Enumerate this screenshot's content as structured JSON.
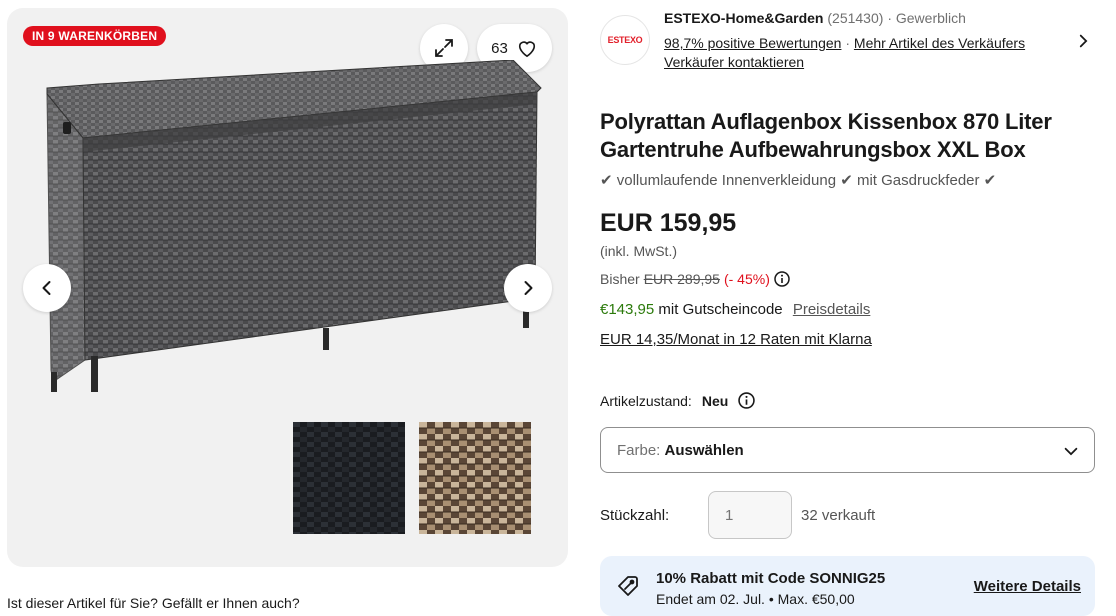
{
  "gallery": {
    "badge": "IN 9 WARENKÖRBEN",
    "watch_count": "63",
    "icons": {
      "expand": "expand-icon",
      "heart": "heart-icon",
      "prev": "chevron-left-icon",
      "next": "chevron-right-icon"
    }
  },
  "seller": {
    "logo_text": "ESTEXO",
    "name": "ESTEXO-Home&Garden",
    "score": "(251430)",
    "type": "Gewerblich",
    "separator": "·",
    "positive": "98,7% positive Bewertungen",
    "more_items": "Mehr Artikel des Verkäufers",
    "contact": "Verkäufer kontaktieren"
  },
  "product": {
    "title": "Polyrattan Auflagenbox Kissenbox 870 Liter Gartentruhe Aufbewahrungsbox XXL Box",
    "subtitle": "✔ vollumlaufende Innenverkleidung ✔ mit Gasdruckfeder ✔",
    "price": "EUR 159,95",
    "vat": "(inkl. MwSt.)",
    "was_label": "Bisher",
    "was_price": "EUR 289,95",
    "discount": "(- 45%)",
    "coupon_price": "€143,95",
    "coupon_text": "mit Gutscheincode",
    "price_details": "Preisdetails",
    "klarna": "EUR 14,35/Monat in 12 Raten mit Klarna"
  },
  "condition": {
    "label": "Artikelzustand:",
    "value": "Neu"
  },
  "color_select": {
    "label": "Farbe:",
    "value": "Auswählen"
  },
  "quantity": {
    "label": "Stückzahl:",
    "placeholder": "1",
    "sold": "32 verkauft"
  },
  "promo": {
    "title": "10% Rabatt mit Code SONNIG25",
    "subtitle": "Endet am 02. Jul. • Max. €50,00",
    "link": "Weitere Details"
  },
  "bottom_peek": "Ist dieser Artikel für Sie? Gefällt er Ihnen auch?"
}
